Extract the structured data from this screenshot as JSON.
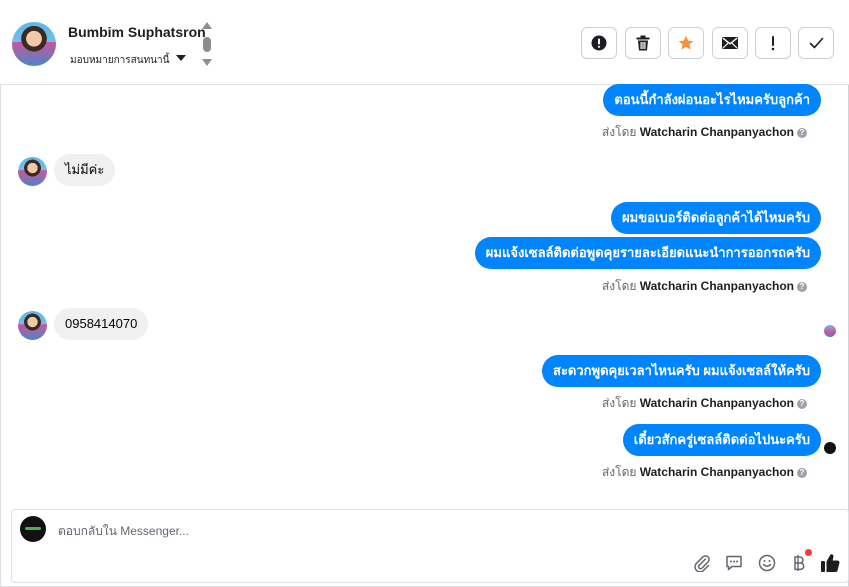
{
  "header": {
    "contact_name": "Bumbim Suphatsron",
    "assign_label": "มอบหมายการสนทนานี้",
    "actions": [
      {
        "name": "spam-report",
        "icon": "alert-circle-icon"
      },
      {
        "name": "delete",
        "icon": "trash-icon"
      },
      {
        "name": "star",
        "icon": "star-icon",
        "color": "#f7923b"
      },
      {
        "name": "mark-unread",
        "icon": "envelope-icon"
      },
      {
        "name": "follow-up",
        "icon": "exclamation-icon"
      },
      {
        "name": "mark-done",
        "icon": "checkmark-icon"
      }
    ]
  },
  "messages": [
    {
      "dir": "out",
      "text": "ตอนนี้กำลังผ่อนอะไรไหมครับลูกค้า"
    },
    {
      "dir": "meta",
      "prefix": "ส่งโดย",
      "sender": "Watcharin Chanpanyachon"
    },
    {
      "dir": "in",
      "text": "ไม่มีค่ะ"
    },
    {
      "dir": "out",
      "text": "ผมขอเบอร์ติดต่อลูกค้าได้ไหมครับ"
    },
    {
      "dir": "out",
      "text": "ผมแจ้งเซลล์ติดต่อพูดคุยรายละเอียดแนะนำการออกรถครับ"
    },
    {
      "dir": "meta",
      "prefix": "ส่งโดย",
      "sender": "Watcharin Chanpanyachon"
    },
    {
      "dir": "in",
      "text": "0958414070"
    },
    {
      "dir": "out",
      "text": "สะดวกพูดคุยเวลาไหนครับ ผมแจ้งเซลล์ให้ครับ"
    },
    {
      "dir": "meta",
      "prefix": "ส่งโดย",
      "sender": "Watcharin Chanpanyachon"
    },
    {
      "dir": "out",
      "text": "เดี๋ยวสักครู่เซลล์ติดต่อไปนะครับ"
    },
    {
      "dir": "meta",
      "prefix": "ส่งโดย",
      "sender": "Watcharin Chanpanyachon"
    }
  ],
  "composer": {
    "placeholder": "ตอบกลับใน Messenger...",
    "icons": [
      "paperclip-icon",
      "saved-reply-icon",
      "emoji-icon",
      "baht-payment-icon",
      "thumbs-up-icon"
    ]
  },
  "colors": {
    "outgoing_bubble": "#0084ff",
    "incoming_bubble": "#f0f0f0",
    "star": "#f7923b",
    "notification_dot": "#fa383e"
  }
}
